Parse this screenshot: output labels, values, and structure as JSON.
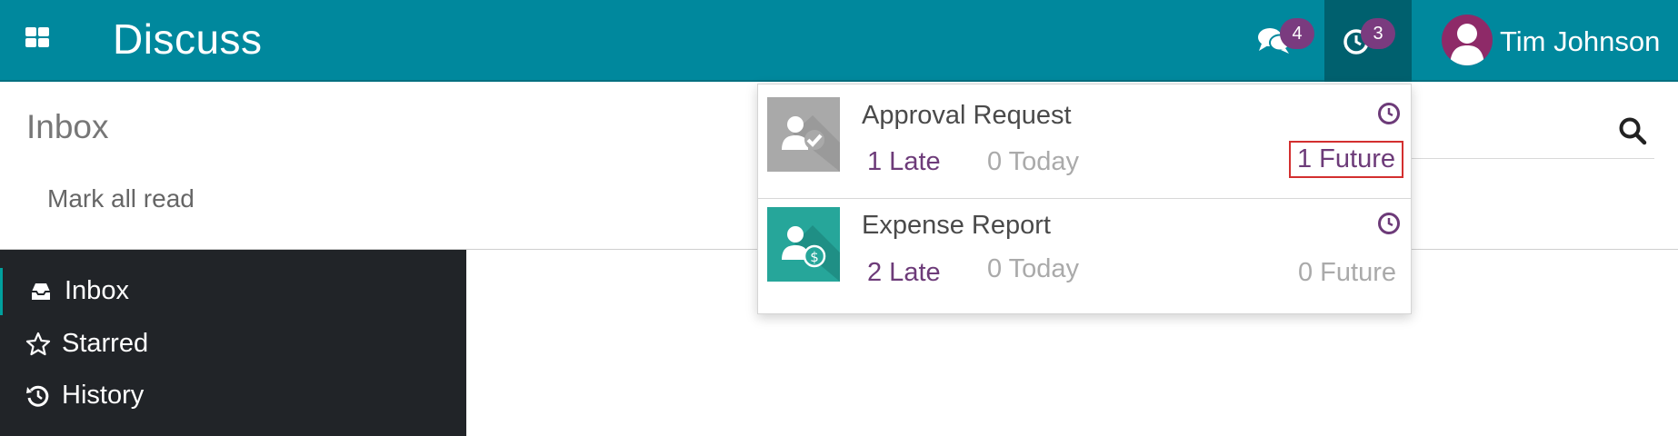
{
  "navbar": {
    "app_title": "Discuss",
    "apps_icon": "grid-icon",
    "messages_badge": "4",
    "activities_badge": "3",
    "user_name": "Tim Johnson",
    "color": "#00889d"
  },
  "control_panel": {
    "title": "Inbox",
    "mark_all_read": "Mark all read"
  },
  "sidebar": {
    "items": [
      {
        "label": "Inbox",
        "icon": "inbox-icon",
        "active": true
      },
      {
        "label": "Starred",
        "icon": "star-icon"
      },
      {
        "label": "History",
        "icon": "history-icon"
      }
    ]
  },
  "activities": [
    {
      "name": "Approval Request",
      "late": "1 Late",
      "today": "0 Today",
      "future": "1 Future",
      "icon": "approval-icon",
      "highlight_future": true
    },
    {
      "name": "Expense Report",
      "late": "2 Late",
      "today": "0 Today",
      "future": "0 Future",
      "icon": "expense-icon"
    }
  ],
  "colors": {
    "navbar": "#00889d",
    "badge": "#7a3b7f",
    "late": "#6d3b79",
    "highlight": "#d32f2f",
    "sidebar": "#212428"
  }
}
